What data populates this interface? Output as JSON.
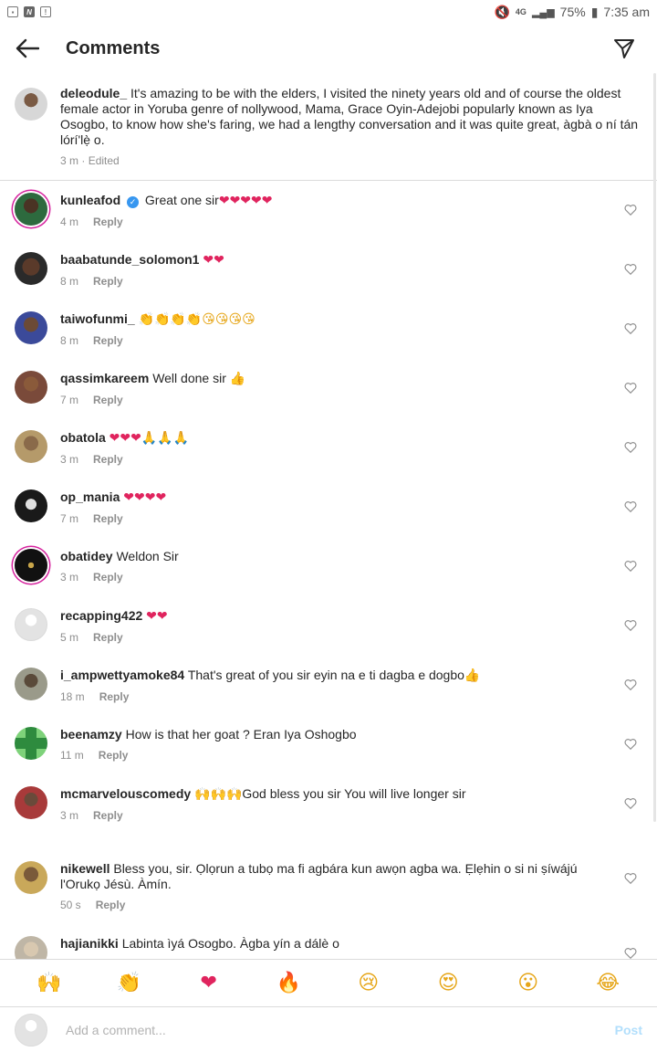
{
  "status_bar": {
    "left_icons": [
      "image-icon",
      "n-icon",
      "alert-icon"
    ],
    "battery": "75%",
    "time": "7:35 am",
    "network": "4G"
  },
  "header": {
    "title": "Comments"
  },
  "caption": {
    "username": "deleodule_",
    "text": "It's amazing to be with the elders, I visited the ninety years old and of course the oldest female actor in Yoruba genre of nollywood, Mama, Grace Oyin-Adejobi popularly known as Iya Osogbo, to know how she's faring, we had a lengthy conversation and it was quite great, àgbà o ní tán lórí'lẹ̀ o.",
    "time": "3 m",
    "edited": "Edited"
  },
  "comments": [
    {
      "username": "kunleafod",
      "verified": true,
      "text": "Great one sir",
      "emojis": "❤❤❤❤❤",
      "time": "4 m",
      "reply": "Reply"
    },
    {
      "username": "baabatunde_solomon1",
      "text": "",
      "emojis": "❤❤",
      "time": "8 m",
      "reply": "Reply"
    },
    {
      "username": "taiwofunmi_",
      "text": "",
      "emojis": "👏👏👏👏😘😘😘😘",
      "time": "8 m",
      "reply": "Reply"
    },
    {
      "username": "qassimkareem",
      "text": "Well done sir",
      "emojis": "👍",
      "time": "7 m",
      "reply": "Reply"
    },
    {
      "username": "obatola",
      "text": "",
      "emojis": "❤❤❤🙏🙏🙏",
      "time": "3 m",
      "reply": "Reply"
    },
    {
      "username": "op_mania",
      "text": "",
      "emojis": "❤❤❤❤",
      "time": "7 m",
      "reply": "Reply"
    },
    {
      "username": "obatidey",
      "text": "Weldon Sir",
      "emojis": "",
      "time": "3 m",
      "reply": "Reply"
    },
    {
      "username": "recapping422",
      "text": "",
      "emojis": "❤❤",
      "time": "5 m",
      "reply": "Reply"
    },
    {
      "username": "i_ampwettyamoke84",
      "text": "That's great of you sir eyin na e ti dagba e dogbo",
      "emojis": "👍",
      "time": "18 m",
      "reply": "Reply"
    },
    {
      "username": "beenamzy",
      "text": "How is that her goat ? Eran  Iya Oshogbo",
      "emojis": "",
      "time": "11 m",
      "reply": "Reply"
    },
    {
      "username": "mcmarvelouscomedy",
      "text": "God bless you sir You will live longer sir",
      "emojis": "🙌🙌🙌",
      "time": "3 m",
      "reply": "Reply"
    },
    {
      "username": "nikewell",
      "text": "Bless you, sir. Ọlọrun a tubọ ma fi agbára kun awọn agba wa. Ẹlẹhin o si ni ṣíwájú l'Orukọ Jésù. Àmín.",
      "emojis": "",
      "time": "50 s",
      "reply": "Reply"
    },
    {
      "username": "hajianikki",
      "text": "Labinta ìyá Osogbo. Àgba yín a dálè o",
      "emojis": "",
      "time": "",
      "reply": ""
    }
  ],
  "emoji_bar": [
    "🙌",
    "👏",
    "❤",
    "🔥",
    "😢",
    "😍",
    "😮",
    "😂"
  ],
  "composer": {
    "placeholder": "Add a comment...",
    "post_label": "Post"
  },
  "colors": {
    "heart": "#e0245e",
    "verified": "#3897f0",
    "post_disabled": "#b2dffc",
    "meta": "#8e8e8e"
  }
}
